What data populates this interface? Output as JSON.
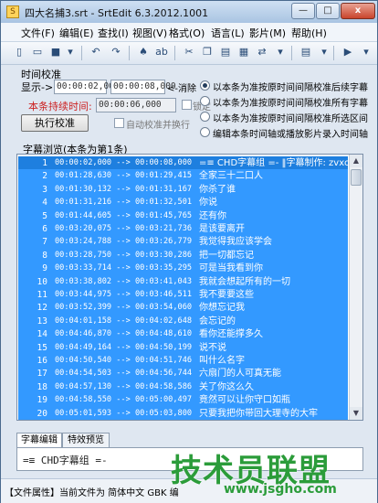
{
  "window": {
    "title": "四大名捕3.srt - SrtEdit 6.3.2012.1001",
    "close": "x",
    "minimize": "—",
    "maximize": "□"
  },
  "menu": [
    "文件(F)",
    "编辑(E)",
    "查找(I)",
    "视图(V)",
    "格式(O)",
    "语言(L)",
    "影片(M)",
    "帮助(H)"
  ],
  "toolbar_icons": [
    "new-file-icon",
    "open-folder-icon",
    "save-icon",
    "undo-icon",
    "redo-icon",
    "find-icon",
    "replace-icon",
    "cut-icon",
    "copy-icon",
    "paste-icon",
    "dropdown-icon",
    "play-icon"
  ],
  "sync": {
    "title": "时间校准",
    "show_label": "显示->",
    "start_time": "00:00:02,000",
    "end_time": "00:00:08,000",
    "erase_label": "<-消除",
    "duration_label": "本条持续时间:",
    "duration_value": "00:00:06,000",
    "lock_label": "锁定",
    "execute_label": "执行校准",
    "auto_label": "自动校准并换行"
  },
  "options": [
    {
      "label": "以本条为准按原时间间隔校准后续字幕",
      "selected": true
    },
    {
      "label": "以本条为准按原时间间隔校准所有字幕",
      "selected": false
    },
    {
      "label": "以本条为准按原时间间隔校准所选区间",
      "selected": false
    },
    {
      "label": "编辑本条时间轴或播放影片录入时间轴",
      "selected": false
    }
  ],
  "browse": {
    "title": "字幕浏览(本条为第1条)",
    "rows": [
      {
        "num": "1",
        "time": "00:00:02,000 --> 00:00:08,000",
        "text": "=≡ CHD字幕组 =- ‖字幕制作: zvxc1220("
      },
      {
        "num": "2",
        "time": "00:01:28,630 --> 00:01:29,415",
        "text": "全家三十二口人"
      },
      {
        "num": "3",
        "time": "00:01:30,132 --> 00:01:31,167",
        "text": "你杀了谁"
      },
      {
        "num": "4",
        "time": "00:01:31,216 --> 00:01:32,501",
        "text": "你说"
      },
      {
        "num": "5",
        "time": "00:01:44,605 --> 00:01:45,765",
        "text": "还有你"
      },
      {
        "num": "6",
        "time": "00:03:20,075 --> 00:03:21,736",
        "text": "是该要离开"
      },
      {
        "num": "7",
        "time": "00:03:24,788 --> 00:03:26,779",
        "text": "我觉得我应该学会"
      },
      {
        "num": "8",
        "time": "00:03:28,750 --> 00:03:30,286",
        "text": "把一切都忘记"
      },
      {
        "num": "9",
        "time": "00:03:33,714 --> 00:03:35,295",
        "text": "可是当我看到你"
      },
      {
        "num": "10",
        "time": "00:03:38,802 --> 00:03:41,043",
        "text": "我就会想起所有的一切"
      },
      {
        "num": "11",
        "time": "00:03:44,975 --> 00:03:46,511",
        "text": "我不要要这些"
      },
      {
        "num": "12",
        "time": "00:03:52,399 --> 00:03:54,060",
        "text": "你想忘记我"
      },
      {
        "num": "13",
        "time": "00:04:01,158 --> 00:04:02,648",
        "text": "会忘记的"
      },
      {
        "num": "14",
        "time": "00:04:46,870 --> 00:04:48,610",
        "text": "看你还能撑多久"
      },
      {
        "num": "15",
        "time": "00:04:49,164 --> 00:04:50,199",
        "text": "说不说"
      },
      {
        "num": "16",
        "time": "00:04:50,540 --> 00:04:51,746",
        "text": "叫什么名字"
      },
      {
        "num": "17",
        "time": "00:04:54,503 --> 00:04:56,744",
        "text": "六扇门的人可真无能"
      },
      {
        "num": "18",
        "time": "00:04:57,130 --> 00:04:58,586",
        "text": "关了你这么久"
      },
      {
        "num": "19",
        "time": "00:04:58,550 --> 00:05:00,497",
        "text": "竟然可以让你守口如瓶"
      },
      {
        "num": "20",
        "time": "00:05:01,593 --> 00:05:03,800",
        "text": "只要我把你带回大理寺的大牢"
      }
    ]
  },
  "tabs": [
    "字幕编辑",
    "特效预览"
  ],
  "editor_text": "=≡ CHD字幕组 =-",
  "status": "【文件属性】当前文件为 简体中文 GBK 编",
  "watermark": {
    "main": "技术员联盟",
    "url": "www.jsgho.com"
  }
}
